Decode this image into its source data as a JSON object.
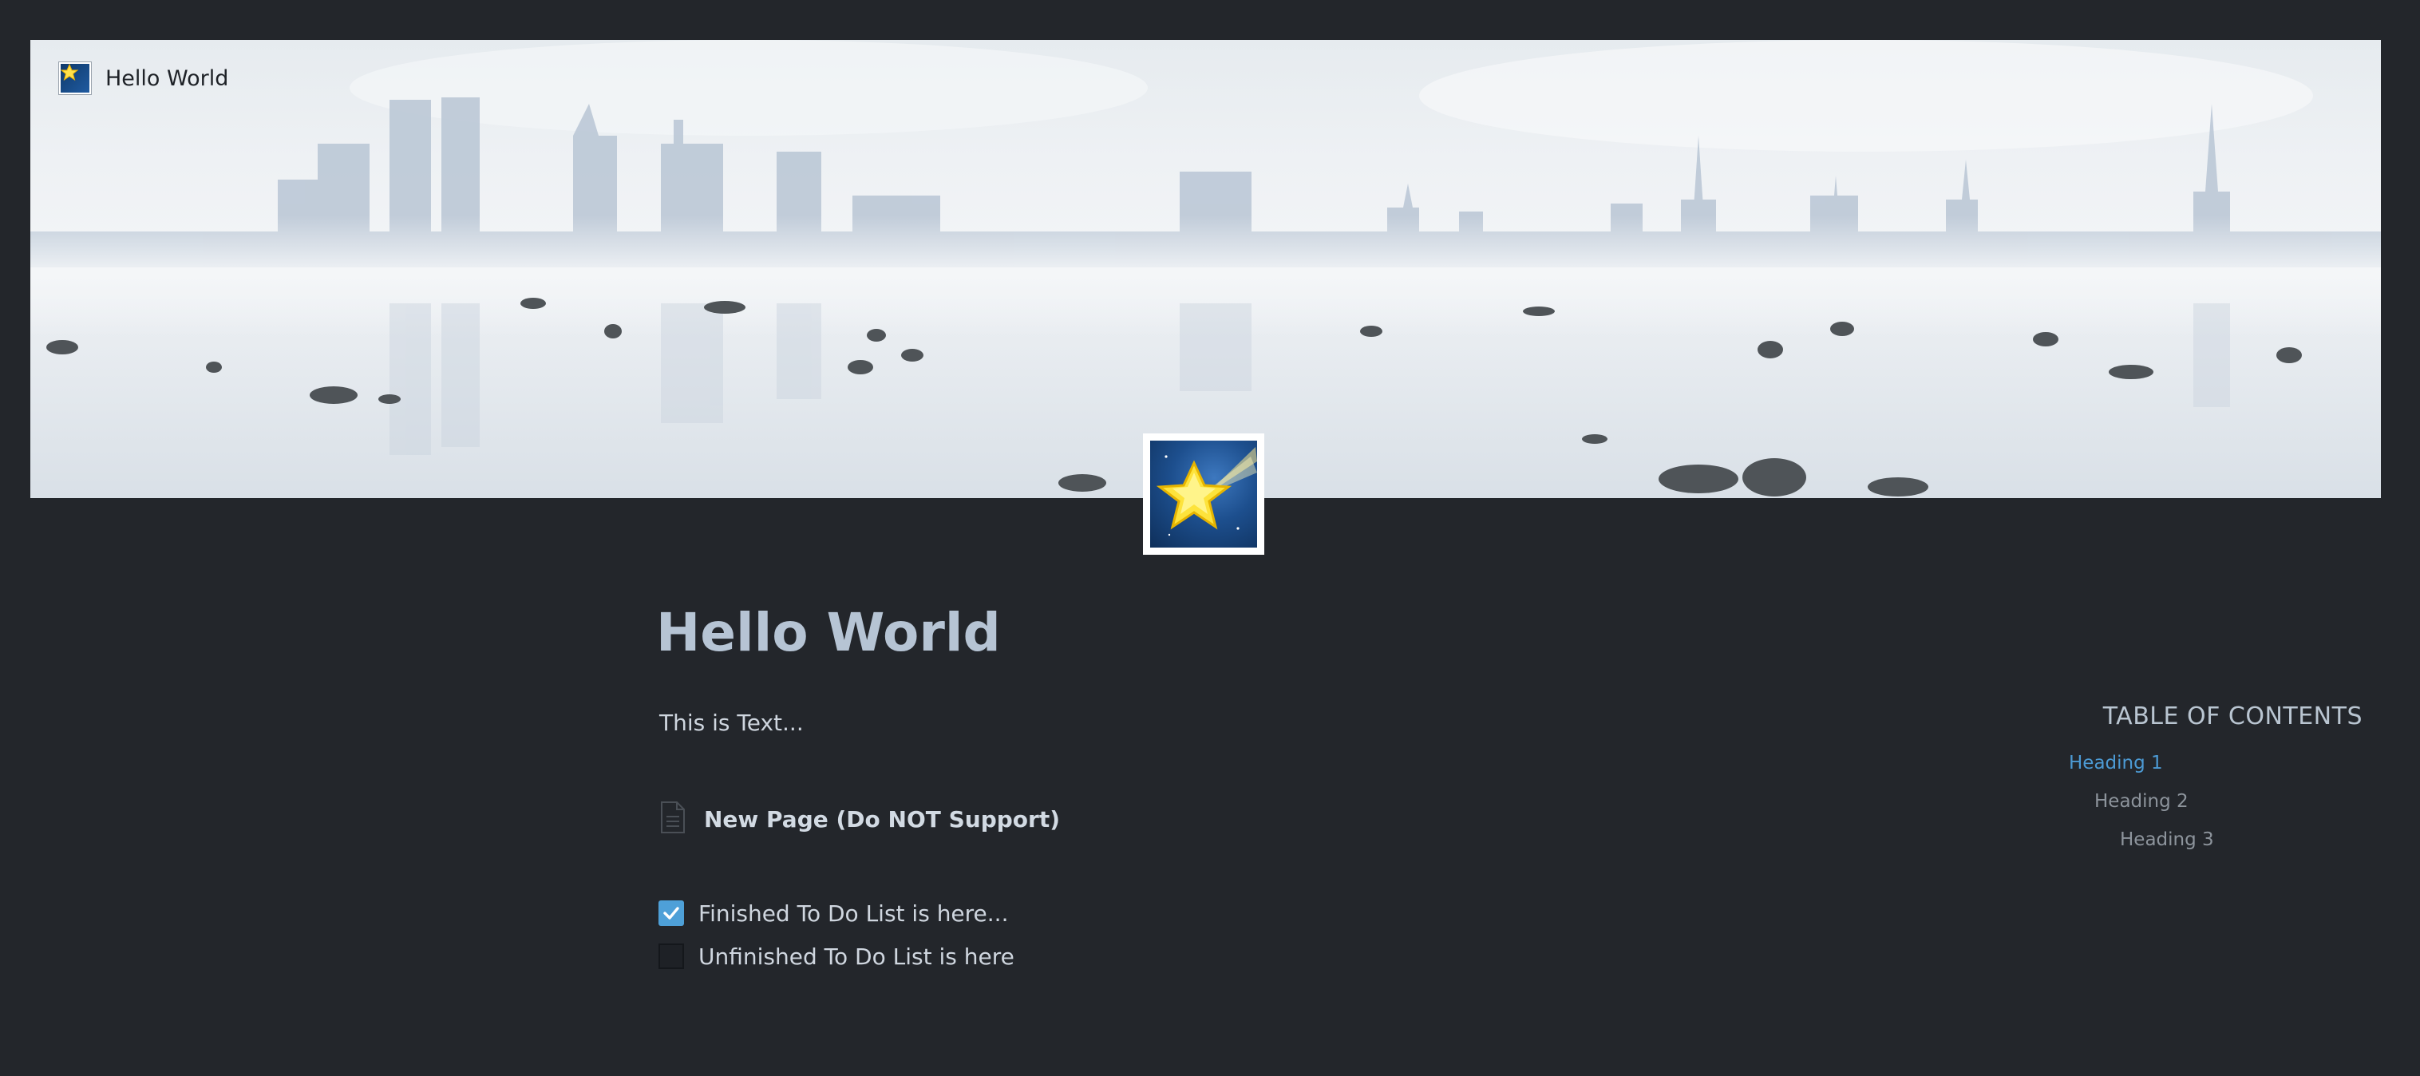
{
  "cover": {
    "nav_title": "Hello World",
    "nav_icon": "shooting-star-icon"
  },
  "page": {
    "icon": "shooting-star-icon",
    "title": "Hello World",
    "text": "This is Text...",
    "subpage": {
      "icon": "document-icon",
      "label": "New Page (Do NOT Support)"
    },
    "todos": [
      {
        "label": "Finished To Do List is here...",
        "checked": true
      },
      {
        "label": "Unfinished To Do List is here",
        "checked": false
      }
    ]
  },
  "toc": {
    "title": "TABLE OF CONTENTS",
    "items": [
      {
        "label": "Heading 1",
        "level": 1,
        "active": true
      },
      {
        "label": "Heading 2",
        "level": 2,
        "active": false
      },
      {
        "label": "Heading 3",
        "level": 3,
        "active": false
      }
    ]
  },
  "colors": {
    "background": "#23262b",
    "accent": "#4ea0d8",
    "title": "#b6c4d4",
    "text": "#cfd6df",
    "muted": "#8d949c"
  }
}
